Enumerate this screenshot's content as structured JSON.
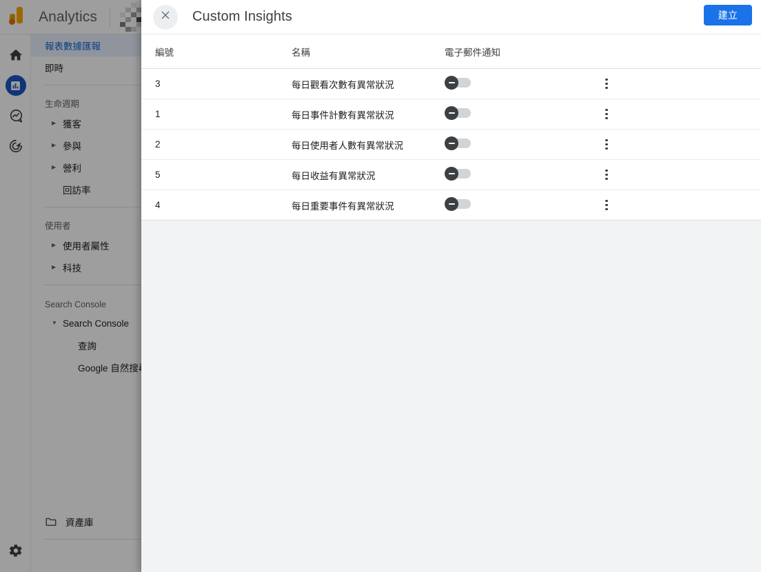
{
  "app": {
    "brand": "Analytics",
    "logo_icon": "google-analytics-logo",
    "property_selector": "pixelated-property-name"
  },
  "rail": {
    "items": [
      {
        "icon": "home-icon",
        "name": "home",
        "selected": false
      },
      {
        "icon": "bar-chart-icon",
        "name": "reports",
        "selected": true
      },
      {
        "icon": "explore-icon",
        "name": "explore",
        "selected": false
      },
      {
        "icon": "advertising-icon",
        "name": "advertising",
        "selected": false
      }
    ],
    "footer": {
      "icon": "gear-icon",
      "name": "admin"
    }
  },
  "sidebar": {
    "items": [
      {
        "label": "報表數據匯報",
        "type": "item",
        "selected": true,
        "expandable": false
      },
      {
        "label": "即時",
        "type": "item",
        "selected": false,
        "expandable": false
      },
      {
        "type": "separator"
      },
      {
        "label": "生命週期",
        "type": "section"
      },
      {
        "label": "獲客",
        "type": "item",
        "expandable": true,
        "expanded": false
      },
      {
        "label": "參與",
        "type": "item",
        "expandable": true,
        "expanded": false
      },
      {
        "label": "營利",
        "type": "item",
        "expandable": true,
        "expanded": false
      },
      {
        "label": "回訪率",
        "type": "item",
        "expandable": false
      },
      {
        "type": "separator"
      },
      {
        "label": "使用者",
        "type": "section"
      },
      {
        "label": "使用者屬性",
        "type": "item",
        "expandable": true,
        "expanded": false
      },
      {
        "label": "科技",
        "type": "item",
        "expandable": true,
        "expanded": false
      },
      {
        "type": "separator"
      },
      {
        "label": "Search Console",
        "type": "section"
      },
      {
        "label": "Search Console",
        "type": "item",
        "expandable": true,
        "expanded": true
      },
      {
        "label": "查詢",
        "type": "subitem"
      },
      {
        "label": "Google 自然搜尋流量",
        "type": "subitem"
      }
    ],
    "footer": {
      "label": "資產庫",
      "icon": "folder-icon"
    }
  },
  "modal": {
    "close_icon": "close-icon",
    "title": "Custom Insights",
    "create_label": "建立",
    "table": {
      "columns": [
        "編號",
        "名稱",
        "電子郵件通知"
      ],
      "rows": [
        {
          "id": "3",
          "name": "每日觀看次數有異常狀況",
          "email_notification": false
        },
        {
          "id": "1",
          "name": "每日事件計數有異常狀況",
          "email_notification": false
        },
        {
          "id": "2",
          "name": "每日使用者人數有異常狀況",
          "email_notification": false
        },
        {
          "id": "5",
          "name": "每日收益有異常狀況",
          "email_notification": false
        },
        {
          "id": "4",
          "name": "每日重要事件有異常狀況",
          "email_notification": false
        }
      ],
      "row_menu_icon": "more-vert-icon",
      "toggle_icon": "toggle-off-minus-icon"
    }
  },
  "colors": {
    "accent_blue": "#1a73e8",
    "selected_nav_bg": "#e8f0fe",
    "selected_nav_text": "#1967d2",
    "logo_orange": "#f9ab00",
    "toggle_knob": "#3c4043",
    "modal_bg": "#f1f3f4"
  }
}
